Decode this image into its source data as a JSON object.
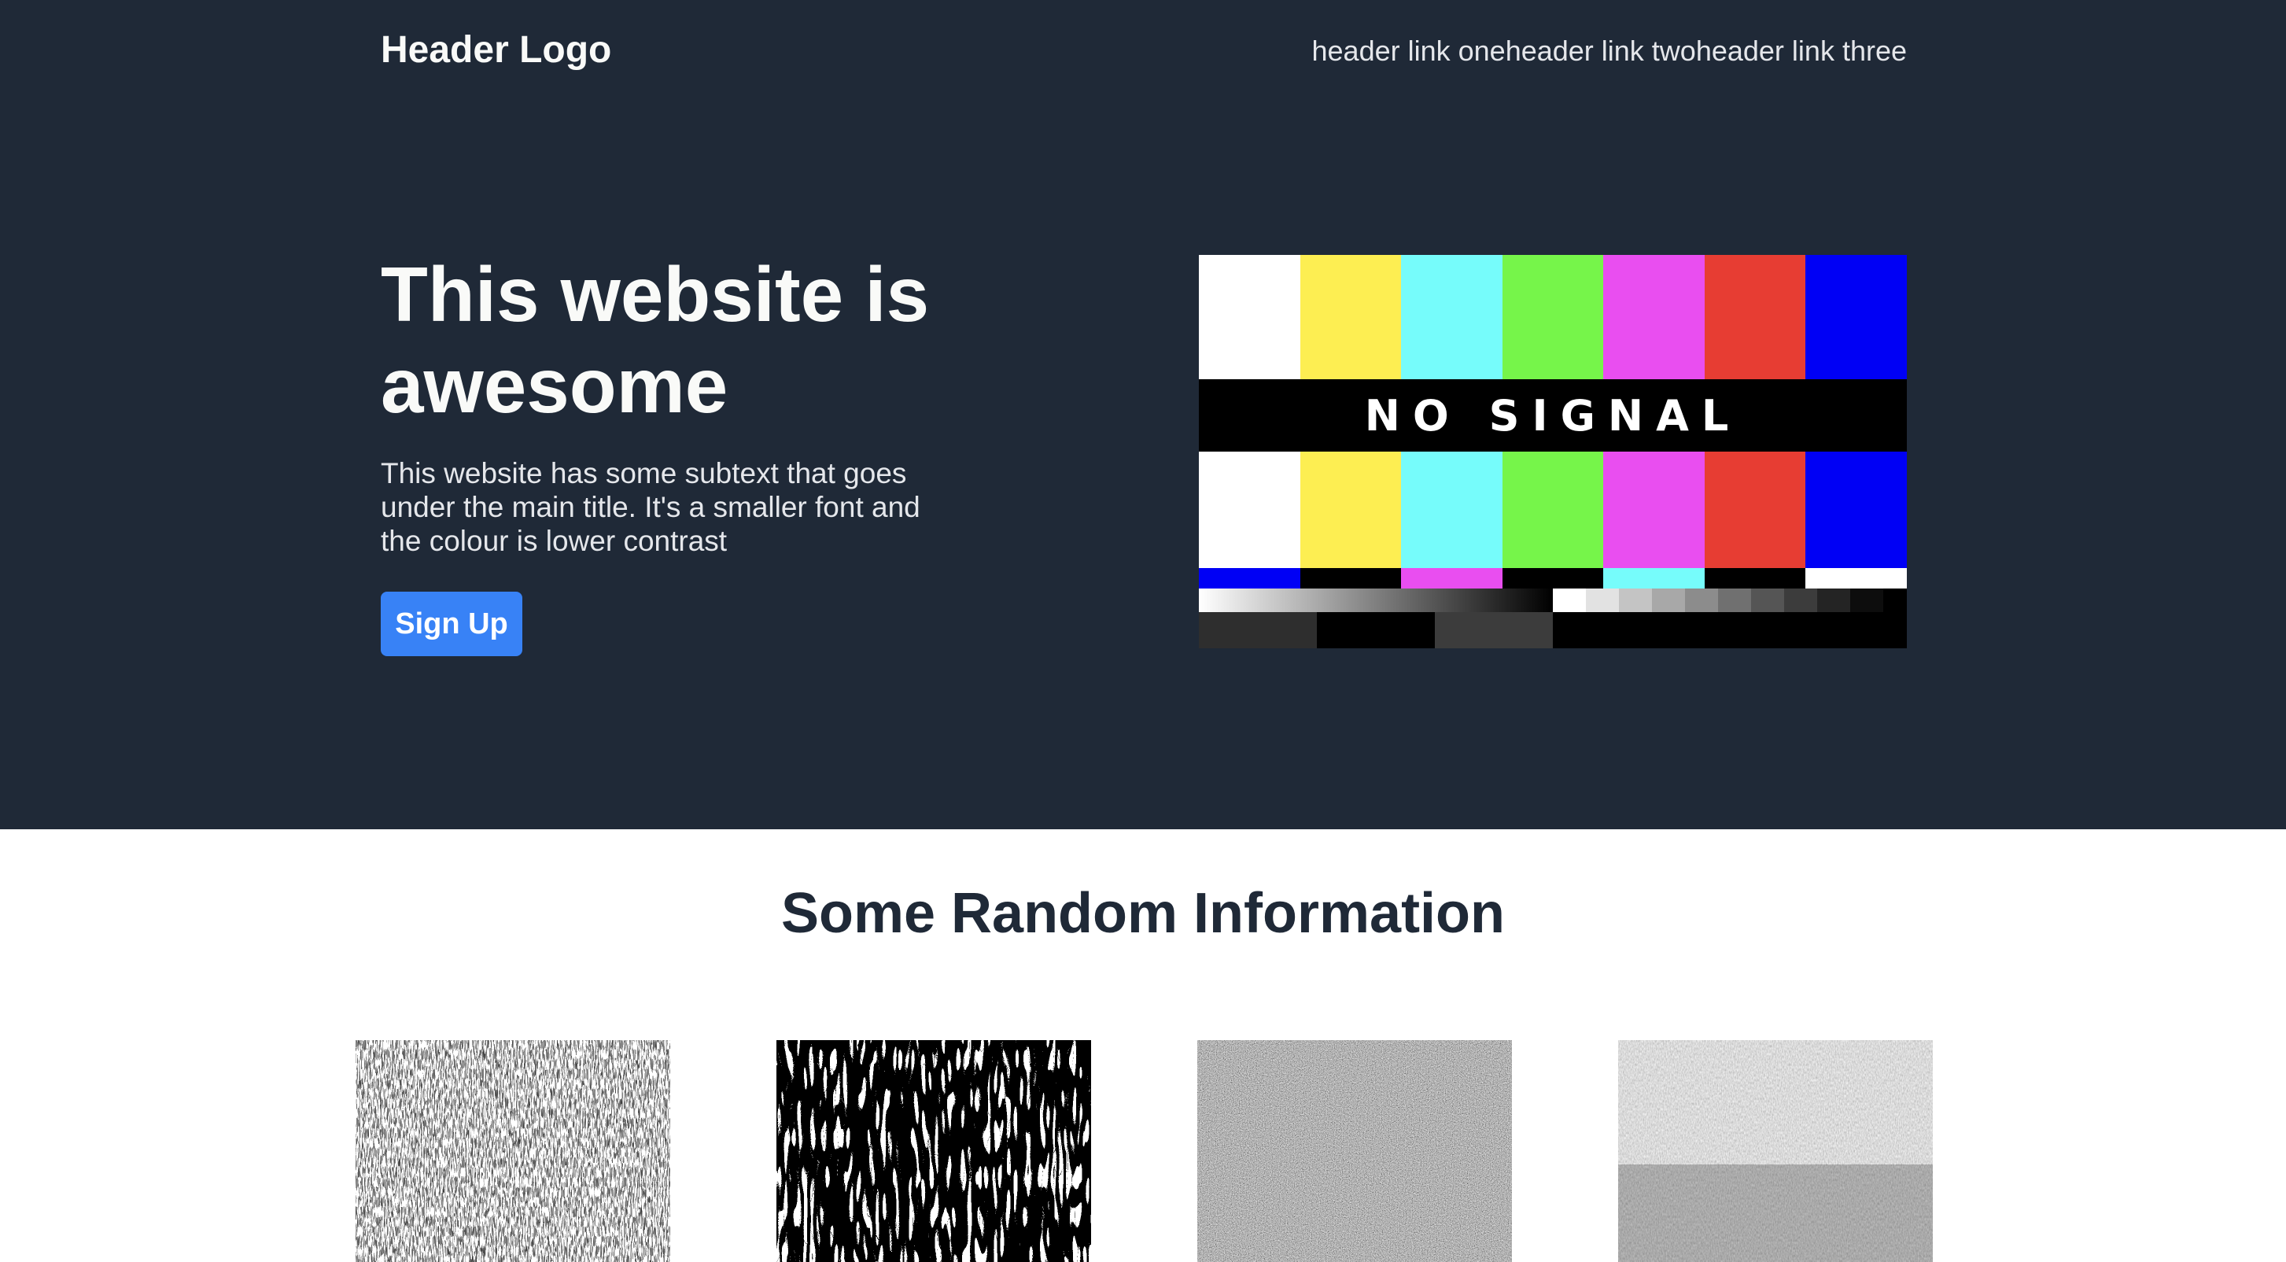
{
  "header": {
    "logo": "Header Logo",
    "links": [
      "header link one",
      "header link two",
      "header link three"
    ]
  },
  "hero": {
    "title": "This website is awesome",
    "subtext": "This website has some subtext that goes under the main title. It's a smaller font and the colour is lower contrast",
    "signup_label": "Sign Up",
    "image_text": "NO SIGNAL",
    "colors": {
      "background": "#1f2937",
      "button": "#3882f6"
    }
  },
  "info": {
    "title": "Some Random Information"
  }
}
